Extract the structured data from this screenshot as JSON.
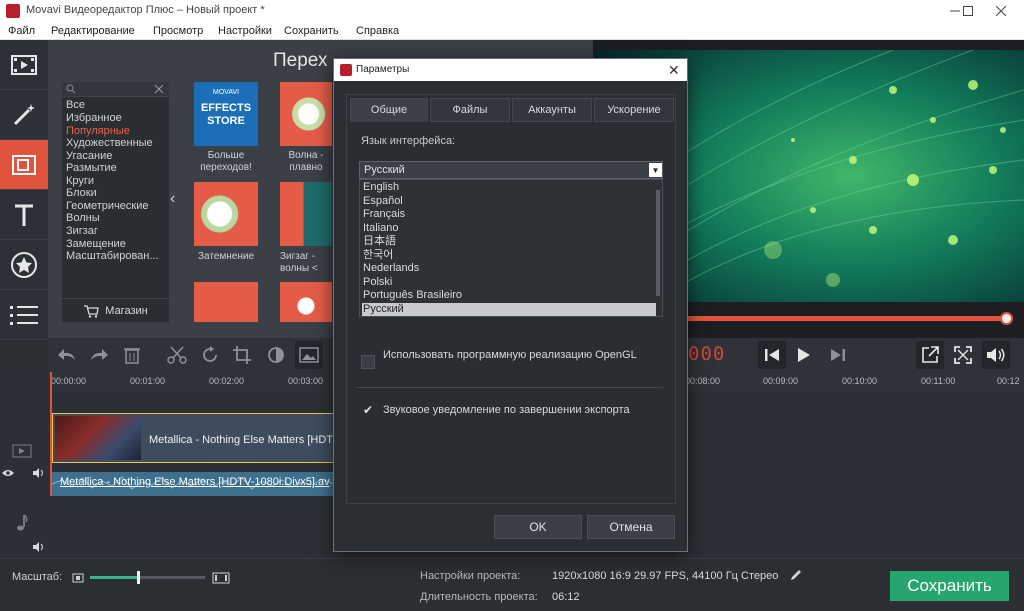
{
  "window": {
    "title": "Movavi Видеоредактор Плюс – Новый проект *"
  },
  "menu": [
    "Файл",
    "Редактирование",
    "Просмотр",
    "Настройки",
    "Сохранить",
    "Справка"
  ],
  "transitions": {
    "title": "Перех",
    "categories": [
      "Все",
      "Избранное",
      "Популярные",
      "Художественные",
      "Угасание",
      "Размытие",
      "Круги",
      "Блоки",
      "Геометрические",
      "Волны",
      "Зигзаг",
      "Замещение",
      "Масштабирован..."
    ],
    "selected_category": "Популярные",
    "store_button": "Магазин",
    "items": [
      {
        "label": "Больше переходов!",
        "badge_line1": "MOVAVI",
        "badge_line2": "EFFECTS",
        "badge_line3": "STORE"
      },
      {
        "label": "Волна - плавно"
      },
      {
        "label": "Затемнение"
      },
      {
        "label": "Зигзаг - волны <"
      }
    ]
  },
  "preview": {
    "timecode": "000",
    "progress": 0.99
  },
  "timeline": {
    "ticks": [
      "00:00:00",
      "00:01:00",
      "00:02:00",
      "00:03:00",
      "00:08:00",
      "00:09:00",
      "00:10:00",
      "00:11:00",
      "00:12"
    ],
    "video_clip": "Metallica - Nothing Else Matters [HDT",
    "audio_clip": "Metallica - Nothing Else Matters [HDTV-1080i.Divx5].av"
  },
  "status": {
    "zoom_label": "Масштаб:",
    "zoom_level": 0.42,
    "settings_label": "Настройки проекта:",
    "settings_value": "1920x1080 16:9 29.97 FPS, 44100 Гц Стерео",
    "duration_label": "Длительность проекта:",
    "duration_value": "06:12",
    "save_button": "Сохранить"
  },
  "dialog": {
    "title": "Параметры",
    "tabs": [
      "Общие",
      "Файлы",
      "Аккаунты",
      "Ускорение"
    ],
    "active_tab": "Общие",
    "language_label": "Язык интерфейса:",
    "language_selected": "Русский",
    "language_options": [
      "English",
      "Español",
      "Français",
      "Italiano",
      "日本語",
      "한국어",
      "Nederlands",
      "Polski",
      "Português Brasileiro",
      "Русский"
    ],
    "opengl_label": "Использовать программную реализацию OpenGL",
    "opengl_checked": false,
    "sound_label": "Звуковое уведомление по завершении экспорта",
    "sound_checked": true,
    "ok_button": "OK",
    "cancel_button": "Отмена"
  },
  "colors": {
    "accent": "#e0533d",
    "save_green": "#26a56e",
    "clip_border": "#f5c04a"
  }
}
